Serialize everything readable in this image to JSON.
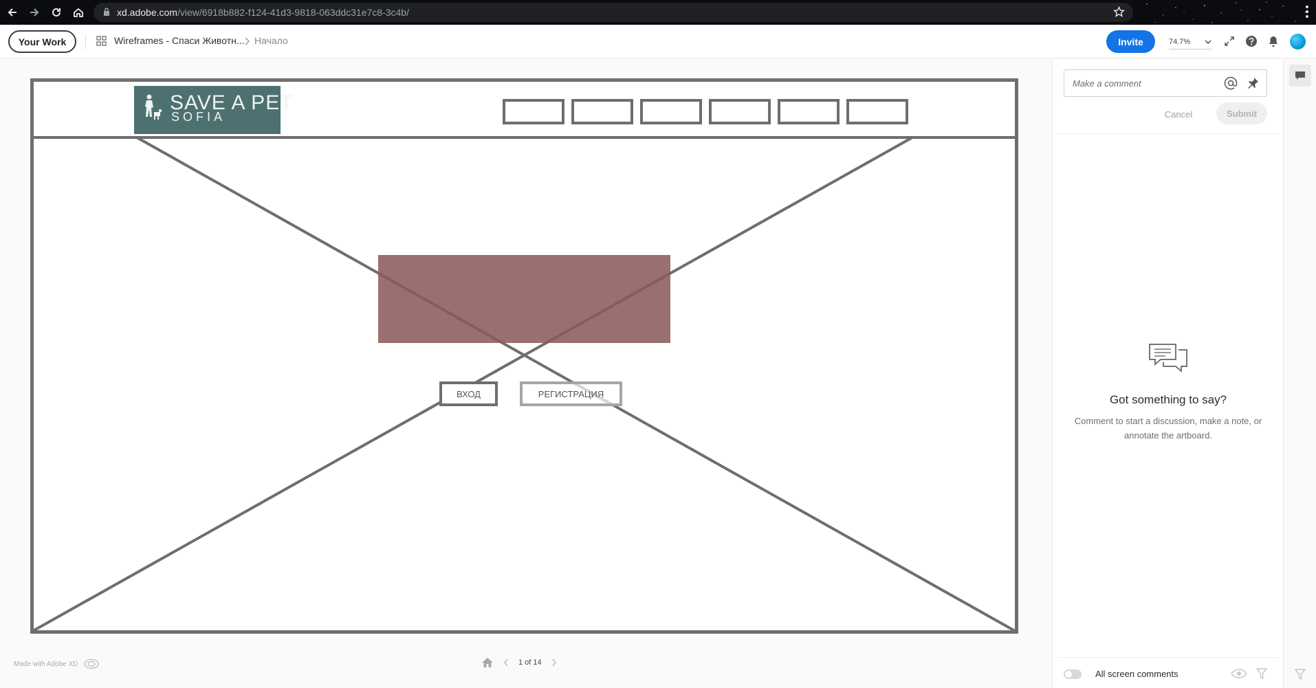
{
  "browser": {
    "url_host": "xd.adobe.com",
    "url_path": "/view/6918b882-f124-41d3-9818-063ddc31e7c8-3c4b/"
  },
  "header": {
    "your_work": "Your Work",
    "doc_title": "Wireframes - Спаси Животн...",
    "breadcrumb_current": "Начало",
    "invite": "Invite",
    "zoom": "74.7%"
  },
  "artboard": {
    "logo_title": "SAVE A PET",
    "logo_subtitle": "SOFIA",
    "login_button": "ВХОД",
    "register_button": "РЕГИСТРАЦИЯ",
    "colors": {
      "logo_bg": "#4c7170",
      "hero_bg": "#8a5b5a",
      "wire": "#6e6e6e"
    }
  },
  "footer": {
    "made_with": "Made with Adobe XD",
    "pager": "1 of 14"
  },
  "comments": {
    "placeholder": "Make a comment",
    "cancel": "Cancel",
    "submit": "Submit",
    "empty_title": "Got something to say?",
    "empty_text": "Comment to start a discussion, make a note, or annotate the artboard.",
    "all_screen_comments": "All screen comments"
  },
  "icons": [
    "back-icon",
    "forward-icon",
    "reload-icon",
    "home-icon",
    "lock-icon",
    "bookmark-star-icon",
    "browser-menu-icon",
    "grid-icon",
    "chevron-right-icon",
    "chevron-down-icon",
    "fullscreen-icon",
    "help-icon",
    "bell-icon",
    "at-icon",
    "pin-icon",
    "chat-bubbles-icon",
    "eye-icon",
    "filter-icon",
    "comment-icon",
    "cc-logo-icon",
    "pager-home-icon",
    "prev-icon",
    "next-icon"
  ],
  "accent_color": "#1473e6"
}
